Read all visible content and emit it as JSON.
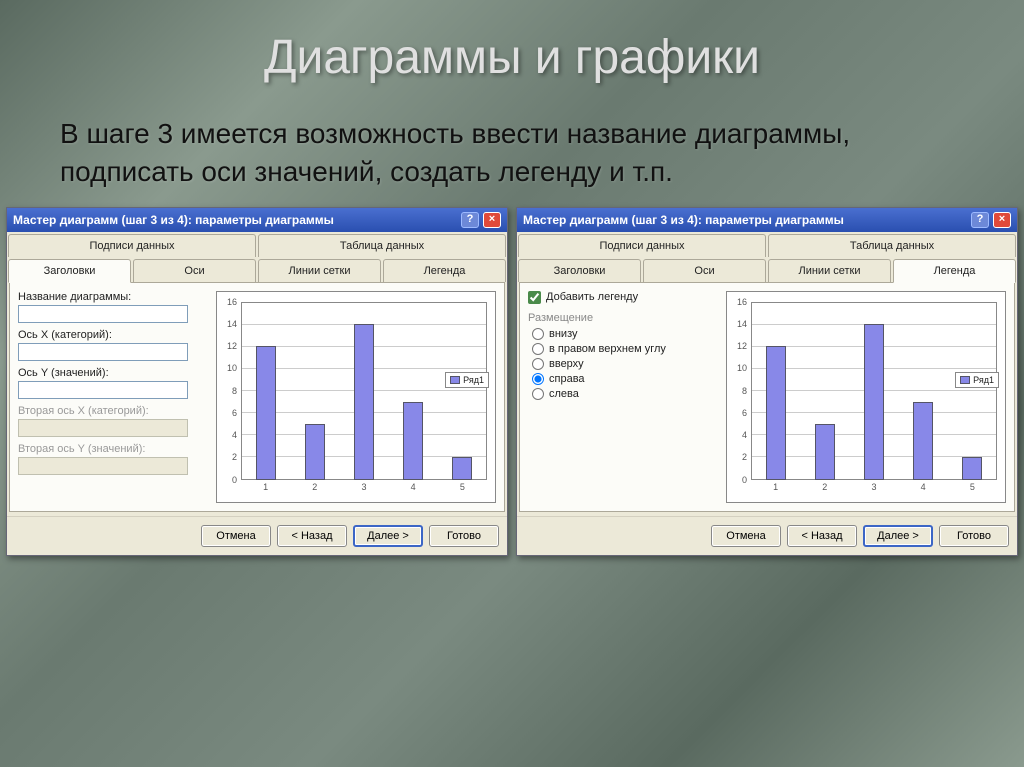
{
  "slide": {
    "title": "Диаграммы и графики",
    "body": "В шаге 3 имеется возможность ввести название диаграммы, подписать оси значений, создать легенду и т.п."
  },
  "dialog_common": {
    "title": "Мастер диаграмм (шаг 3 из 4): параметры диаграммы",
    "help": "?",
    "close": "×",
    "tabs_top": {
      "data_labels": "Подписи данных",
      "data_table": "Таблица данных"
    },
    "tabs_bottom": {
      "titles": "Заголовки",
      "axes": "Оси",
      "gridlines": "Линии сетки",
      "legend": "Легенда"
    },
    "buttons": {
      "cancel": "Отмена",
      "back": "< Назад",
      "next": "Далее >",
      "finish": "Готово"
    },
    "legend_label": "Ряд1"
  },
  "dialog1": {
    "labels": {
      "chart_title": "Название диаграммы:",
      "x_axis": "Ось X (категорий):",
      "y_axis": "Ось Y (значений):",
      "x2_axis": "Вторая ось X (категорий):",
      "y2_axis": "Вторая ось Y (значений):"
    }
  },
  "dialog2": {
    "add_legend_label": "Добавить легенду",
    "placement_caption": "Размещение",
    "options": {
      "bottom": "внизу",
      "top_right": "в правом верхнем углу",
      "top": "вверху",
      "right": "справа",
      "left": "слева"
    }
  },
  "chart_data": {
    "type": "bar",
    "categories": [
      "1",
      "2",
      "3",
      "4",
      "5"
    ],
    "values": [
      12,
      5,
      14,
      7,
      2
    ],
    "yticks": [
      0,
      2,
      4,
      6,
      8,
      10,
      12,
      14,
      16
    ],
    "ylim": [
      0,
      16
    ],
    "series_name": "Ряд1",
    "title": "",
    "xlabel": "",
    "ylabel": ""
  }
}
